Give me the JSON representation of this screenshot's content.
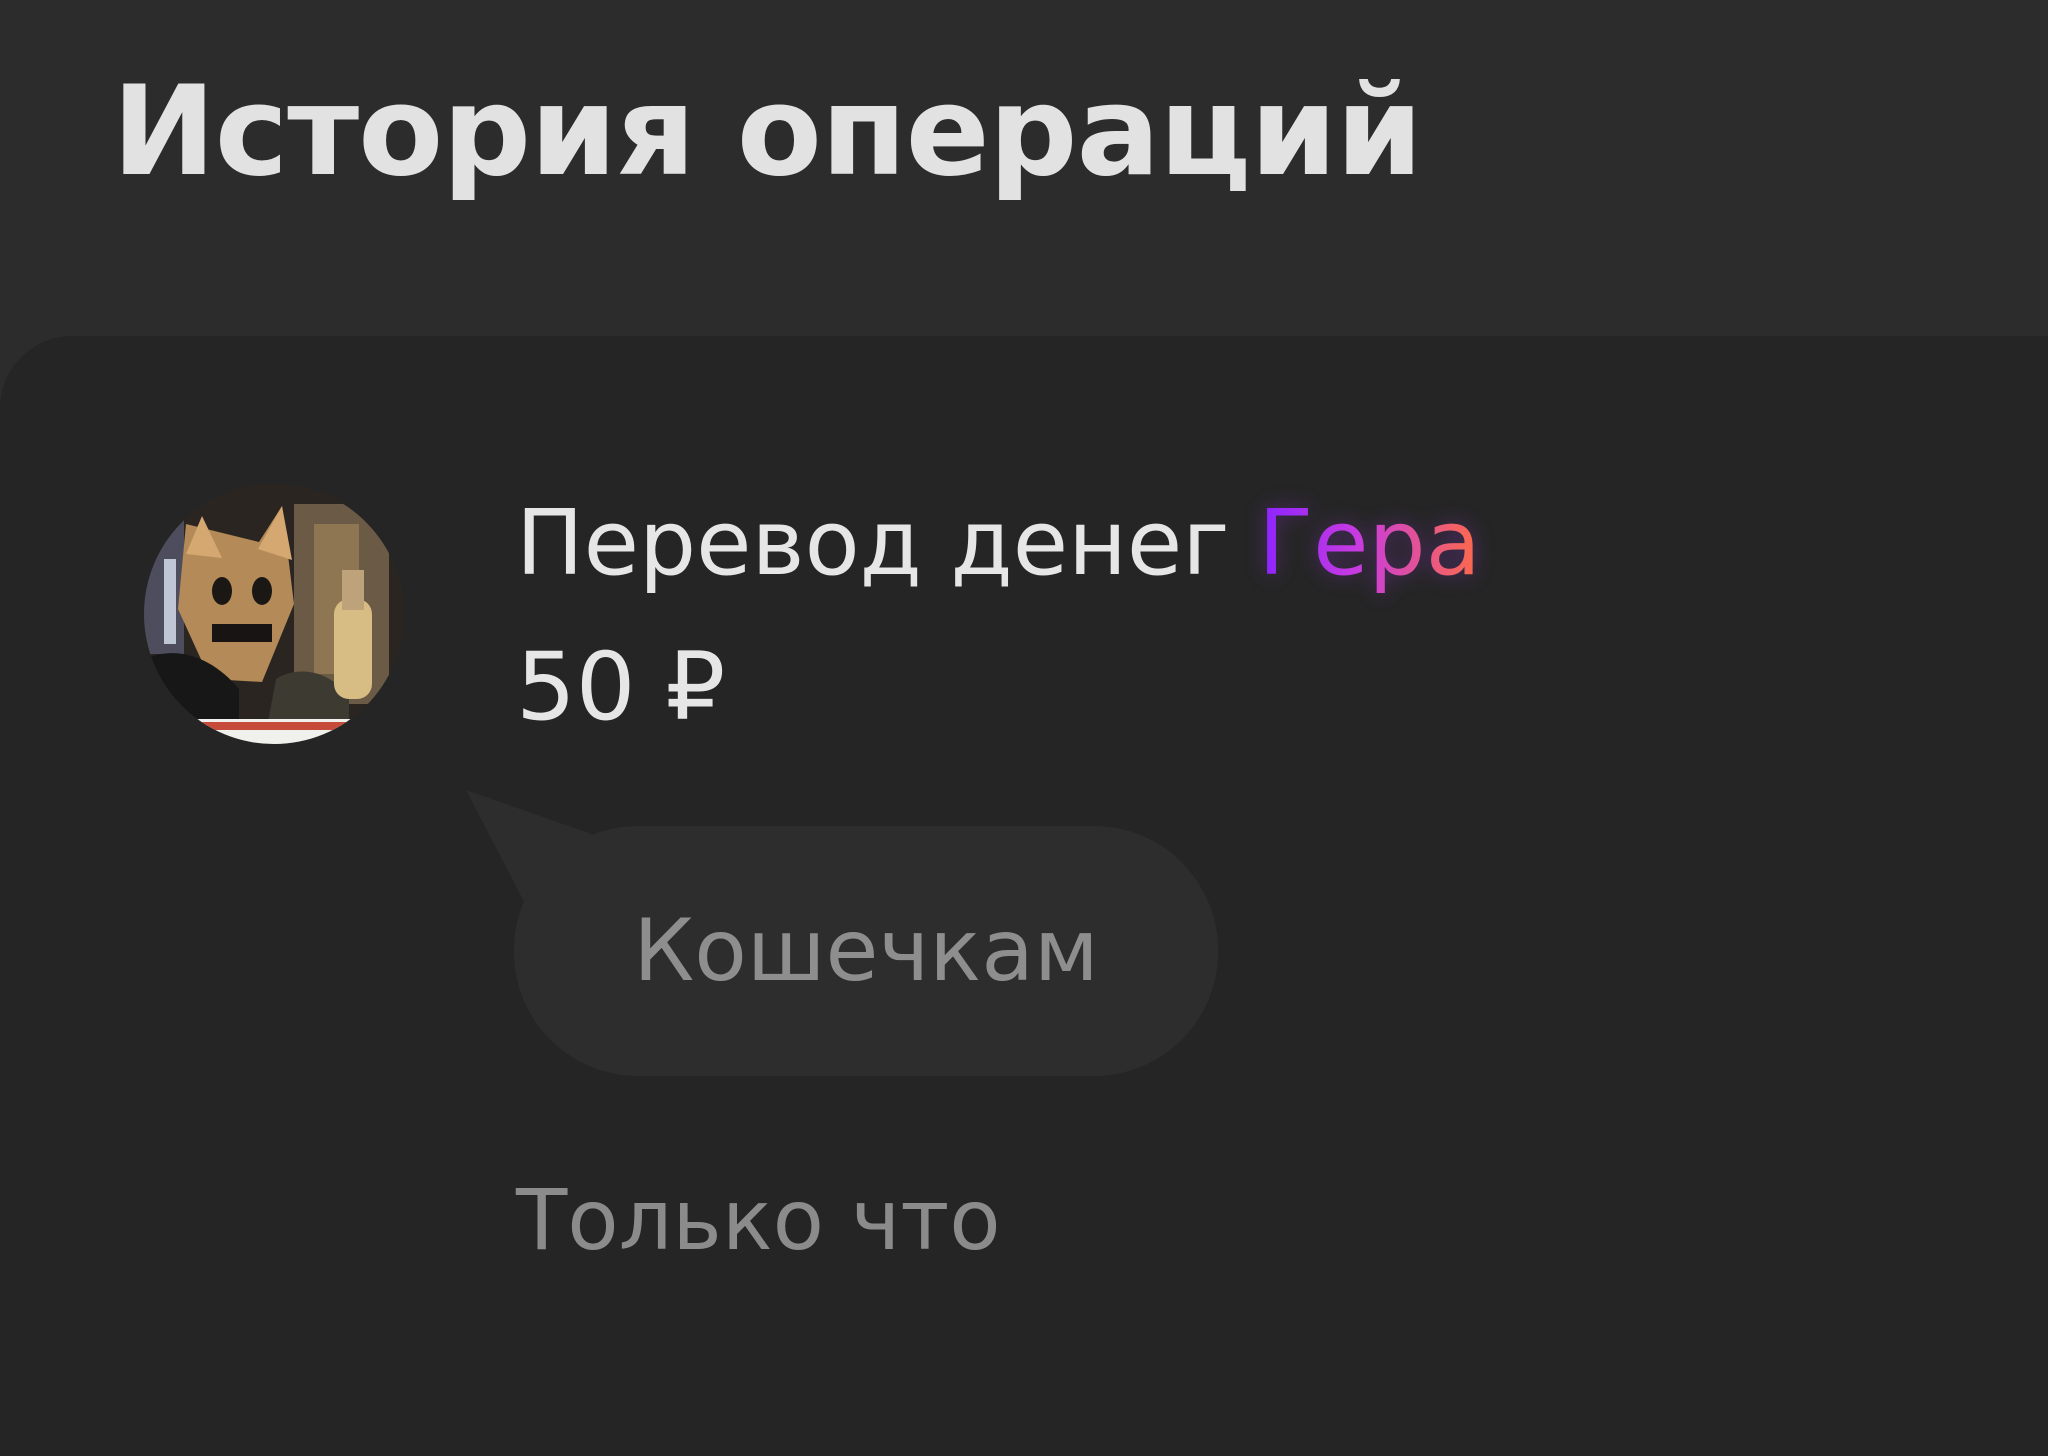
{
  "page": {
    "title": "История операций"
  },
  "transaction": {
    "title_prefix": "Перевод денег",
    "recipient": "Гера",
    "amount": "50 ₽",
    "comment": "Кошечкам",
    "time": "Только что",
    "avatar_icon": "cat-photo-avatar"
  },
  "colors": {
    "background": "#2c2c2d",
    "card": "#252525",
    "bubble": "#2d2d2e",
    "primary_text": "#e6e6e6",
    "muted_text": "#8b8b8b",
    "recipient_gradient_start": "#8b24ff",
    "recipient_gradient_mid": "#c83be0",
    "recipient_gradient_end": "#ff6b46"
  }
}
